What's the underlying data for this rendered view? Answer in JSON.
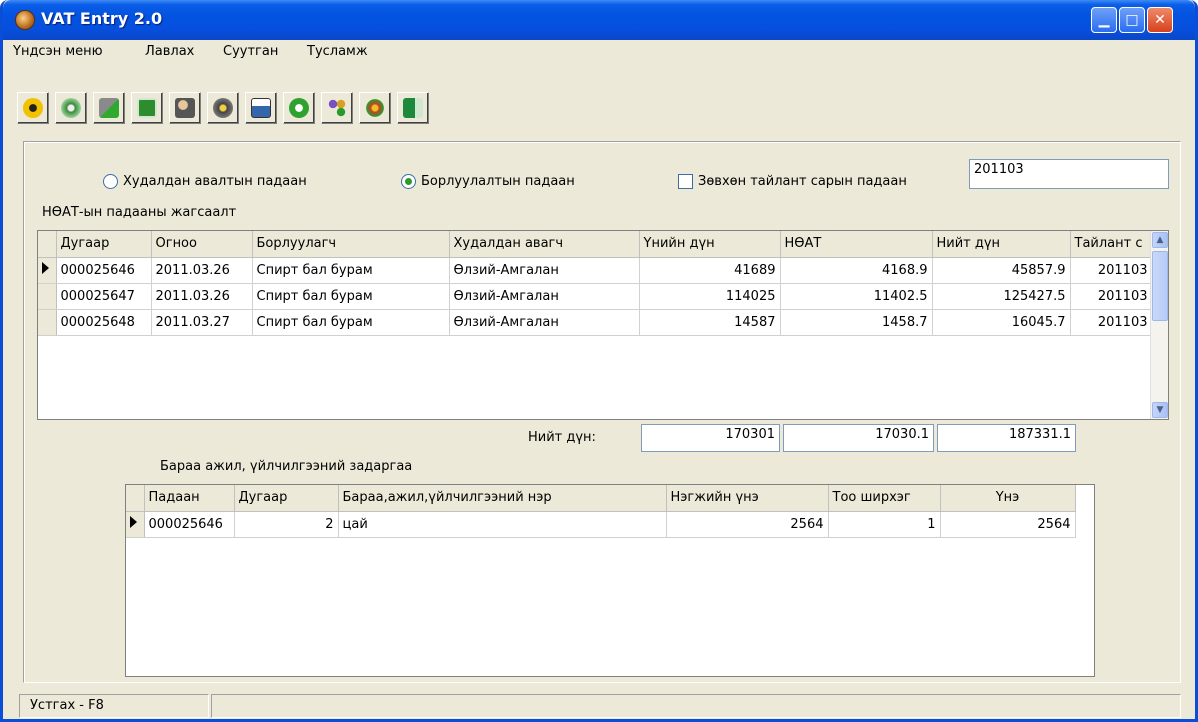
{
  "window": {
    "title": "VAT Entry 2.0"
  },
  "menu": [
    "Үндсэн меню",
    "Лавлах",
    "Суутган",
    "Тусламж"
  ],
  "toolbar": {
    "icons": [
      "flower-icon",
      "gear-flower-icon",
      "import-icon",
      "excel-icon",
      "users-icon",
      "settings-icon",
      "report-icon",
      "info-icon",
      "tools-icon",
      "asterisk-icon",
      "exit-icon"
    ],
    "colors": [
      "#f2c200",
      "#3c8a3c",
      "#6b6b6b",
      "#2e8b2e",
      "#555",
      "#444",
      "#3366aa",
      "#2fa12f",
      "#7a4fc4",
      "#c8402a",
      "#1c8a3a"
    ]
  },
  "filters": {
    "purchase_label": "Худалдан авалтын падаан",
    "sales_label": "Борлуулалтын падаан",
    "period_only_label": "Зөвхөн тайлант сарын падаан",
    "period_value": "201103"
  },
  "invoice_list": {
    "caption": "НӨАТ-ын падааны жагсаалт",
    "headers": [
      "Дугаар",
      "Огноо",
      "Борлуулагч",
      "Худалдан авагч",
      "Үнийн дүн",
      "НӨАТ",
      "Нийт дүн",
      "Тайлант с"
    ],
    "rows": [
      [
        "000025646",
        "2011.03.26",
        "Спирт бал бурам",
        "Өлзий-Амгалан",
        "41689",
        "4168.9",
        "45857.9",
        "201103"
      ],
      [
        "000025647",
        "2011.03.26",
        "Спирт бал бурам",
        "Өлзий-Амгалан",
        "114025",
        "11402.5",
        "125427.5",
        "201103"
      ],
      [
        "000025648",
        "2011.03.27",
        "Спирт бал бурам",
        "Өлзий-Амгалан",
        "14587",
        "1458.7",
        "16045.7",
        "201103"
      ]
    ]
  },
  "totals": {
    "label": "Нийт дүн:",
    "amount": "170301",
    "vat": "17030.1",
    "total": "187331.1"
  },
  "detail_list": {
    "caption": "Бараа ажил, үйлчилгээний задаргаа",
    "headers": [
      "Падаан",
      "Дугаар",
      "Бараа,ажил,үйлчилгээний нэр",
      "Нэгжийн үнэ",
      "Тоо ширхэг",
      "Үнэ"
    ],
    "rows": [
      [
        "000025646",
        "2",
        "цай",
        "2564",
        "1",
        "2564"
      ]
    ]
  },
  "status": {
    "hint": "Устгах - F8"
  }
}
